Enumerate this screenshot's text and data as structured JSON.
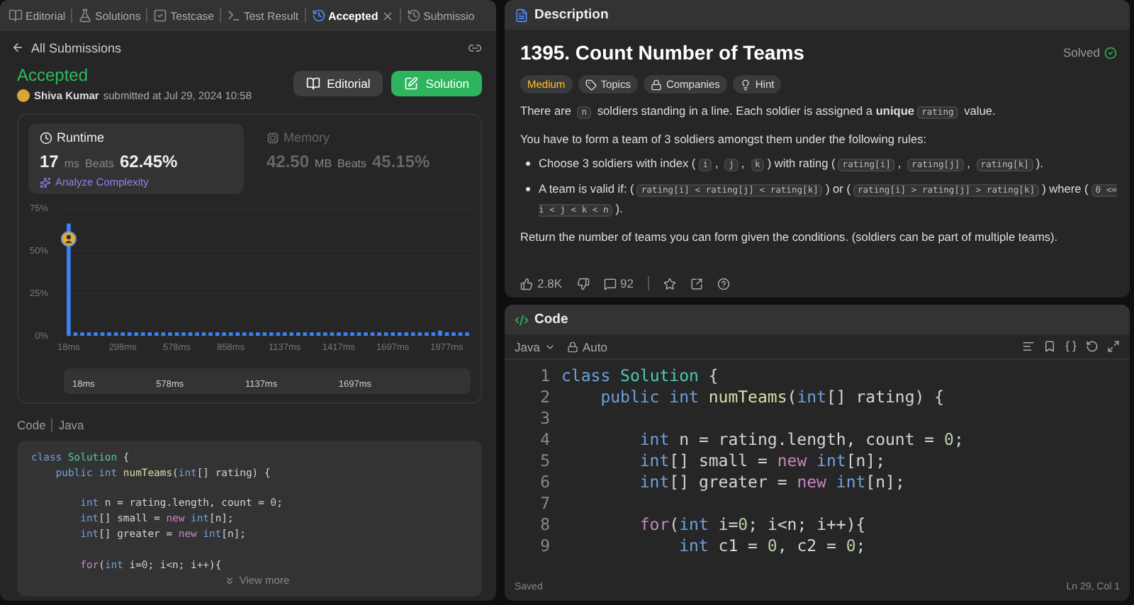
{
  "left_tabs": [
    {
      "label": "Editorial",
      "selected": false,
      "closable": false
    },
    {
      "label": "Solutions",
      "selected": false,
      "closable": false
    },
    {
      "label": "Testcase",
      "selected": false,
      "closable": false
    },
    {
      "label": "Test Result",
      "selected": false,
      "closable": false
    },
    {
      "label": "Accepted",
      "selected": true,
      "closable": true
    },
    {
      "label": "Submissio",
      "selected": false,
      "closable": false
    }
  ],
  "back_link": "All Submissions",
  "submission": {
    "status": "Accepted",
    "author": "Shiva Kumar",
    "submitted": "submitted at Jul 29, 2024 10:58"
  },
  "actions": [
    {
      "label": "Editorial",
      "kind": "secondary"
    },
    {
      "label": "Solution",
      "kind": "primary"
    }
  ],
  "metrics": [
    {
      "title": "Runtime",
      "kind": "runtime",
      "value": "17",
      "unit": "ms",
      "beats_label": "Beats",
      "beats": "62.45%",
      "selected": true,
      "link": "Analyze Complexity"
    },
    {
      "title": "Memory",
      "kind": "memory",
      "value": "42.50",
      "unit": "MB",
      "beats_label": "Beats",
      "beats": "45.15%",
      "selected": false
    }
  ],
  "chart_data": {
    "type": "bar",
    "xlim": [
      0,
      2100
    ],
    "ylim": [
      0,
      75
    ],
    "yticks": [
      {
        "value": 0,
        "label": "0%"
      },
      {
        "value": 25,
        "label": "25%"
      },
      {
        "value": 50,
        "label": "50%"
      },
      {
        "value": 75,
        "label": "75%"
      }
    ],
    "x": [
      18,
      53,
      88,
      123,
      158,
      193,
      228,
      263,
      298,
      333,
      368,
      403,
      438,
      473,
      508,
      543,
      578,
      613,
      648,
      683,
      718,
      753,
      788,
      823,
      858,
      893,
      928,
      963,
      998,
      1033,
      1068,
      1103,
      1137,
      1172,
      1207,
      1242,
      1277,
      1312,
      1347,
      1382,
      1417,
      1452,
      1487,
      1522,
      1557,
      1592,
      1627,
      1662,
      1697,
      1732,
      1767,
      1802,
      1837,
      1872,
      1907,
      1942,
      1977,
      2012,
      2047,
      2082
    ],
    "xticks": [
      {
        "value": 18,
        "label": "18ms"
      },
      {
        "value": 298,
        "label": "298ms"
      },
      {
        "value": 578,
        "label": "578ms"
      },
      {
        "value": 858,
        "label": "858ms"
      },
      {
        "value": 1137,
        "label": "1137ms"
      },
      {
        "value": 1417,
        "label": "1417ms"
      },
      {
        "value": 1697,
        "label": "1697ms"
      },
      {
        "value": 1977,
        "label": "1977ms"
      }
    ],
    "series": [
      {
        "color": "#3b82f6",
        "values": [
          66,
          2,
          2,
          2,
          2,
          2,
          2,
          2,
          2,
          2,
          2,
          2,
          2,
          2,
          2,
          2,
          2,
          2,
          2,
          2,
          2,
          2,
          2,
          2,
          2,
          2,
          2,
          2,
          2,
          2,
          2,
          2,
          2,
          2,
          2,
          2,
          2,
          2,
          2,
          2,
          2,
          2,
          2,
          2,
          2,
          2,
          2,
          2,
          2,
          2,
          2,
          2,
          2,
          2,
          2,
          3,
          2,
          2,
          2,
          2
        ]
      }
    ]
  },
  "navigator_labels": [
    "18ms",
    "578ms",
    "1137ms",
    "1697ms"
  ],
  "code_section": {
    "label": "Code",
    "language": "Java",
    "more": "View more",
    "lines": [
      {
        "kind": "code",
        "tokens": [
          {
            "kind": "kw",
            "text": "class "
          },
          {
            "kind": "cls",
            "text": "Solution"
          },
          {
            "kind": "plain",
            "text": " {"
          }
        ]
      },
      {
        "kind": "code",
        "tokens": [
          {
            "kind": "kw",
            "text": "    public int "
          },
          {
            "kind": "fn",
            "text": "numTeams"
          },
          {
            "kind": "plain",
            "text": "("
          },
          {
            "kind": "kw",
            "text": "int"
          },
          {
            "kind": "plain",
            "text": "[] rating) {"
          }
        ]
      },
      {
        "kind": "blank"
      },
      {
        "kind": "code",
        "tokens": [
          {
            "kind": "kw",
            "text": "        int"
          },
          {
            "kind": "plain",
            "text": " n = rating.length, count = "
          },
          {
            "kind": "num",
            "text": "0"
          },
          {
            "kind": "plain",
            "text": ";"
          }
        ]
      },
      {
        "kind": "code",
        "tokens": [
          {
            "kind": "kw",
            "text": "        int"
          },
          {
            "kind": "plain",
            "text": "[] small = "
          },
          {
            "kind": "new",
            "text": "new "
          },
          {
            "kind": "kw",
            "text": "int"
          },
          {
            "kind": "plain",
            "text": "[n];"
          }
        ]
      },
      {
        "kind": "code",
        "tokens": [
          {
            "kind": "kw",
            "text": "        int"
          },
          {
            "kind": "plain",
            "text": "[] greater = "
          },
          {
            "kind": "new",
            "text": "new "
          },
          {
            "kind": "kw",
            "text": "int"
          },
          {
            "kind": "plain",
            "text": "[n];"
          }
        ]
      },
      {
        "kind": "blank"
      },
      {
        "kind": "code",
        "tokens": [
          {
            "kind": "new",
            "text": "        for"
          },
          {
            "kind": "plain",
            "text": "("
          },
          {
            "kind": "kw",
            "text": "int"
          },
          {
            "kind": "plain",
            "text": " i="
          },
          {
            "kind": "num",
            "text": "0"
          },
          {
            "kind": "plain",
            "text": "; i<n; i++){"
          }
        ]
      }
    ]
  },
  "description": {
    "tab": "Description",
    "title": "1395. Count Number of Teams",
    "status": "Solved",
    "tags": [
      {
        "label": "Medium",
        "kind": "difficulty"
      },
      {
        "label": "Topics",
        "kind": "topics"
      },
      {
        "label": "Companies",
        "kind": "companies"
      },
      {
        "label": "Hint",
        "kind": "hint"
      }
    ],
    "paragraphs": [
      {
        "kind": "para",
        "parts": [
          {
            "kind": "text",
            "text": "There are "
          },
          {
            "kind": "code",
            "text": "n"
          },
          {
            "kind": "text",
            "text": " soldiers standing in a line. Each soldier is assigned a "
          },
          {
            "kind": "bold",
            "text": "unique"
          },
          {
            "kind": "code",
            "text": "rating"
          },
          {
            "kind": "text",
            "text": " value."
          }
        ]
      },
      {
        "kind": "para",
        "parts": [
          {
            "kind": "text",
            "text": "You have to form a team of 3 soldiers amongst them under the following rules:"
          }
        ]
      },
      {
        "kind": "bullet",
        "parts": [
          {
            "kind": "text",
            "text": "Choose 3 soldiers with index ("
          },
          {
            "kind": "code",
            "text": "i"
          },
          {
            "kind": "text",
            "text": ", "
          },
          {
            "kind": "code",
            "text": "j"
          },
          {
            "kind": "text",
            "text": ", "
          },
          {
            "kind": "code",
            "text": "k"
          },
          {
            "kind": "text",
            "text": ") with rating ("
          },
          {
            "kind": "code",
            "text": "rating[i]"
          },
          {
            "kind": "text",
            "text": ", "
          },
          {
            "kind": "code",
            "text": "rating[j]"
          },
          {
            "kind": "text",
            "text": ", "
          },
          {
            "kind": "code",
            "text": "rating[k]"
          },
          {
            "kind": "text",
            "text": ")."
          }
        ]
      },
      {
        "kind": "bullet",
        "parts": [
          {
            "kind": "text",
            "text": "A team is valid if: ("
          },
          {
            "kind": "code",
            "text": "rating[i] < rating[j] < rating[k]"
          },
          {
            "kind": "text",
            "text": ") or ("
          },
          {
            "kind": "code",
            "text": "rating[i] > rating[j] > rating[k]"
          },
          {
            "kind": "text",
            "text": ") where ("
          },
          {
            "kind": "code",
            "text": "0 <= i < j < k < n"
          },
          {
            "kind": "text",
            "text": ")."
          }
        ]
      },
      {
        "kind": "para",
        "parts": [
          {
            "kind": "text",
            "text": "Return the number of teams you can form given the conditions. (soldiers can be part of multiple teams)."
          }
        ]
      }
    ],
    "likes": "2.8K",
    "comments": "92"
  },
  "editor": {
    "tab": "Code",
    "language": "Java",
    "mode": "Auto",
    "status": "Saved",
    "cursor": "Ln 29, Col 1",
    "lines": [
      {
        "number": "1",
        "kind": "code",
        "tokens": [
          {
            "kind": "kw",
            "text": "class "
          },
          {
            "kind": "cls",
            "text": "Solution"
          },
          {
            "kind": "plain",
            "text": " {"
          }
        ]
      },
      {
        "number": "2",
        "kind": "code",
        "tokens": [
          {
            "kind": "kw",
            "text": "    public int "
          },
          {
            "kind": "fn",
            "text": "numTeams"
          },
          {
            "kind": "plain",
            "text": "("
          },
          {
            "kind": "kw",
            "text": "int"
          },
          {
            "kind": "plain",
            "text": "[] rating) {"
          }
        ]
      },
      {
        "number": "3",
        "kind": "blank"
      },
      {
        "number": "4",
        "kind": "code",
        "tokens": [
          {
            "kind": "kw",
            "text": "        int"
          },
          {
            "kind": "plain",
            "text": " n = rating.length, count = "
          },
          {
            "kind": "num",
            "text": "0"
          },
          {
            "kind": "plain",
            "text": ";"
          }
        ]
      },
      {
        "number": "5",
        "kind": "code",
        "tokens": [
          {
            "kind": "kw",
            "text": "        int"
          },
          {
            "kind": "plain",
            "text": "[] small = "
          },
          {
            "kind": "new",
            "text": "new "
          },
          {
            "kind": "kw",
            "text": "int"
          },
          {
            "kind": "plain",
            "text": "[n];"
          }
        ]
      },
      {
        "number": "6",
        "kind": "code",
        "tokens": [
          {
            "kind": "kw",
            "text": "        int"
          },
          {
            "kind": "plain",
            "text": "[] greater = "
          },
          {
            "kind": "new",
            "text": "new "
          },
          {
            "kind": "kw",
            "text": "int"
          },
          {
            "kind": "plain",
            "text": "[n];"
          }
        ]
      },
      {
        "number": "7",
        "kind": "blank"
      },
      {
        "number": "8",
        "kind": "code",
        "tokens": [
          {
            "kind": "new",
            "text": "        for"
          },
          {
            "kind": "plain",
            "text": "("
          },
          {
            "kind": "kw",
            "text": "int"
          },
          {
            "kind": "plain",
            "text": " i="
          },
          {
            "kind": "num",
            "text": "0"
          },
          {
            "kind": "plain",
            "text": "; i<n; i++){"
          }
        ]
      },
      {
        "number": "9",
        "kind": "code",
        "tokens": [
          {
            "kind": "kw",
            "text": "            int"
          },
          {
            "kind": "plain",
            "text": " c1 = "
          },
          {
            "kind": "num",
            "text": "0"
          },
          {
            "kind": "plain",
            "text": ", c2 = "
          },
          {
            "kind": "num",
            "text": "0"
          },
          {
            "kind": "plain",
            "text": ";"
          }
        ]
      }
    ]
  }
}
